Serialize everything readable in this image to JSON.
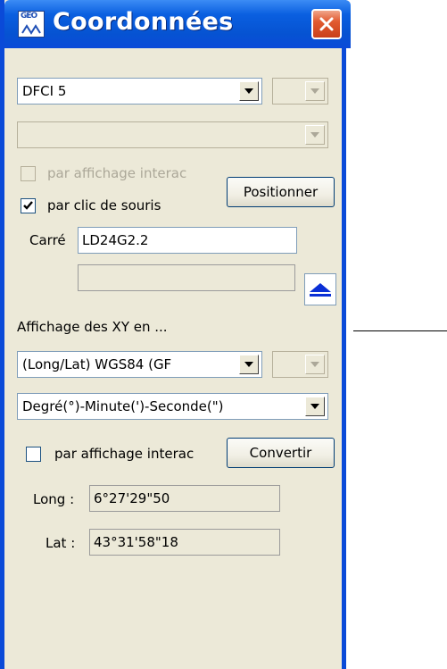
{
  "window": {
    "title": "Coordonnées",
    "app_icon_text": "GEO"
  },
  "grid_section": {
    "system_select": {
      "value": "DFCI 5"
    },
    "system_subselect": {
      "value": ""
    },
    "secondary_select": {
      "value": ""
    },
    "interactive_display_checkbox": {
      "label": "par affichage interac",
      "checked": false,
      "enabled": false
    },
    "mouse_click_checkbox": {
      "label": "par clic de souris",
      "checked": true,
      "enabled": true
    },
    "position_button_label": "Positionner",
    "square_label": "Carré",
    "square_value": "LD24G2.2",
    "secondary_field_value": ""
  },
  "xy_section": {
    "heading": "Affichage des XY en ...",
    "projection_select": {
      "value": "(Long/Lat) WGS84 (GF"
    },
    "projection_subselect": {
      "value": ""
    },
    "format_select": {
      "value": "Degré(°)-Minute(')-Seconde(\")"
    },
    "interactive_checkbox": {
      "label": "par affichage interac",
      "checked": false,
      "enabled": true
    },
    "convert_button_label": "Convertir",
    "long_label": "Long :",
    "long_value": "6°27'29\"50",
    "lat_label": "Lat :",
    "lat_value": "43°31'58\"18"
  },
  "colors": {
    "titlebar": "#0a4ad8",
    "window_bg": "#ece9d8",
    "close_button": "#e25b31"
  }
}
